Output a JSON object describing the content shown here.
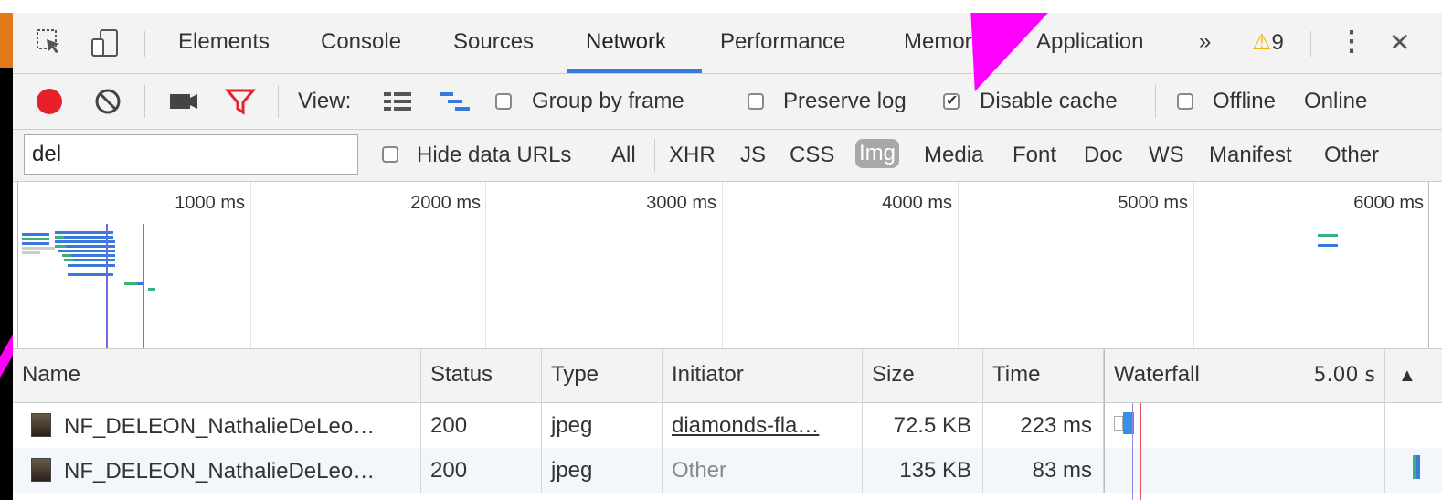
{
  "tabs": {
    "elements": "Elements",
    "console": "Console",
    "sources": "Sources",
    "network": "Network",
    "performance": "Performance",
    "memory": "Memory",
    "application": "Application",
    "more": "»",
    "warnings_count": "9",
    "kebab": "⋮",
    "close": "✕"
  },
  "toolbar": {
    "view_label": "View:",
    "group_by_frame": "Group by frame",
    "preserve_log": "Preserve log",
    "disable_cache": "Disable cache",
    "disable_cache_checked": true,
    "offline": "Offline",
    "throttle": "Online"
  },
  "filter": {
    "value": "del",
    "hide_data_urls": "Hide data URLs",
    "types": [
      "All",
      "XHR",
      "JS",
      "CSS",
      "Img",
      "Media",
      "Font",
      "Doc",
      "WS",
      "Manifest",
      "Other"
    ],
    "active_type": "Img"
  },
  "overview": {
    "ticks": [
      "1000 ms",
      "2000 ms",
      "3000 ms",
      "4000 ms",
      "5000 ms",
      "6000 ms"
    ]
  },
  "table": {
    "columns": {
      "name": "Name",
      "status": "Status",
      "type": "Type",
      "initiator": "Initiator",
      "size": "Size",
      "time": "Time",
      "waterfall": "Waterfall",
      "waterfall_scale": "5.00 s",
      "sort_icon": "▲"
    },
    "rows": [
      {
        "name": "NF_DELEON_NathalieDeLeo…",
        "status": "200",
        "type": "jpeg",
        "initiator": "diamonds-fla…",
        "size": "72.5 KB",
        "time": "223 ms"
      },
      {
        "name": "NF_DELEON_NathalieDeLeo…",
        "status": "200",
        "type": "jpeg",
        "initiator": "Other",
        "size": "135 KB",
        "time": "83 ms"
      }
    ]
  },
  "colors": {
    "record": "#e8202a",
    "filter_active": "#e8202a",
    "tab_underline": "#3879d9",
    "warning": "#f4b400",
    "annotation": "#ff00ff"
  }
}
